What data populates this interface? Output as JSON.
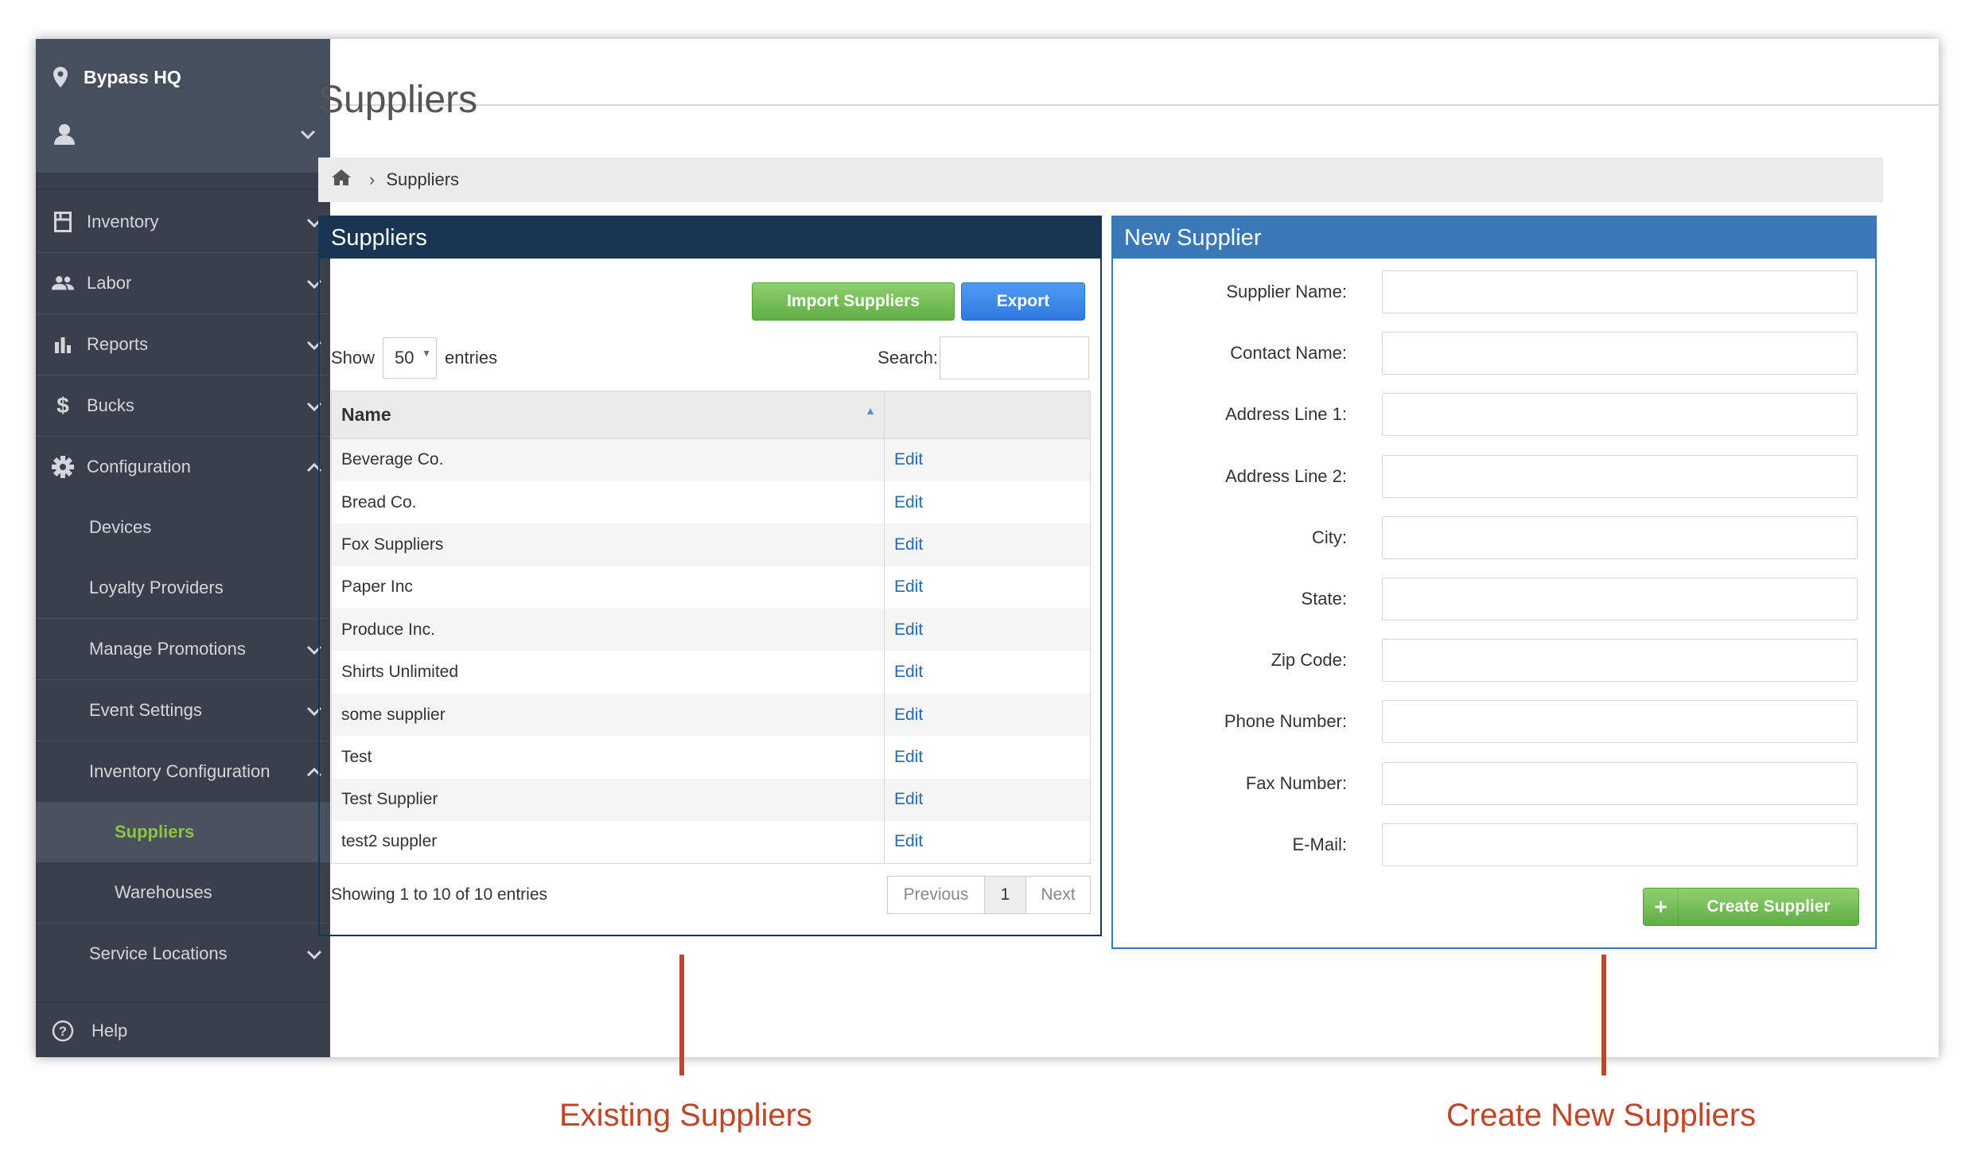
{
  "sidebar": {
    "location": "Bypass HQ",
    "items": [
      {
        "label": "Inventory"
      },
      {
        "label": "Labor"
      },
      {
        "label": "Reports"
      },
      {
        "label": "Bucks"
      },
      {
        "label": "Configuration"
      },
      {
        "label": "Devices"
      },
      {
        "label": "Loyalty Providers"
      },
      {
        "label": "Manage Promotions"
      },
      {
        "label": "Event Settings"
      },
      {
        "label": "Inventory Configuration"
      },
      {
        "label": "Suppliers"
      },
      {
        "label": "Warehouses"
      },
      {
        "label": "Service Locations"
      },
      {
        "label": "Help"
      }
    ],
    "active_color": "#8cc63f"
  },
  "page": {
    "title": "Suppliers",
    "breadcrumb_current": "Suppliers"
  },
  "suppliers_panel": {
    "title": "Suppliers",
    "import_label": "Import Suppliers",
    "export_label": "Export",
    "show_label": "Show",
    "entries_value": "50",
    "entries_label": "entries",
    "search_label": "Search:",
    "column_name": "Name",
    "rows": [
      {
        "name": "Beverage Co.",
        "action": "Edit"
      },
      {
        "name": "Bread Co.",
        "action": "Edit"
      },
      {
        "name": "Fox Suppliers",
        "action": "Edit"
      },
      {
        "name": "Paper Inc",
        "action": "Edit"
      },
      {
        "name": "Produce Inc.",
        "action": "Edit"
      },
      {
        "name": "Shirts Unlimited",
        "action": "Edit"
      },
      {
        "name": "some supplier",
        "action": "Edit"
      },
      {
        "name": "Test",
        "action": "Edit"
      },
      {
        "name": "Test Supplier",
        "action": "Edit"
      },
      {
        "name": "test2 suppler",
        "action": "Edit"
      }
    ],
    "info": "Showing 1 to 10 of 10 entries",
    "prev_label": "Previous",
    "current_page": "1",
    "next_label": "Next"
  },
  "new_supplier_panel": {
    "title": "New Supplier",
    "fields": [
      {
        "label": "Supplier Name:",
        "value": ""
      },
      {
        "label": "Contact Name:",
        "value": ""
      },
      {
        "label": "Address Line 1:",
        "value": ""
      },
      {
        "label": "Address Line 2:",
        "value": ""
      },
      {
        "label": "City:",
        "value": ""
      },
      {
        "label": "State:",
        "value": ""
      },
      {
        "label": "Zip Code:",
        "value": ""
      },
      {
        "label": "Phone Number:",
        "value": ""
      },
      {
        "label": "Fax Number:",
        "value": ""
      },
      {
        "label": "E-Mail:",
        "value": ""
      }
    ],
    "create_label": "Create Supplier",
    "create_icon": "+"
  },
  "annotations": {
    "left": "Existing Suppliers",
    "right": "Create New Suppliers",
    "color": "#c0462a"
  }
}
